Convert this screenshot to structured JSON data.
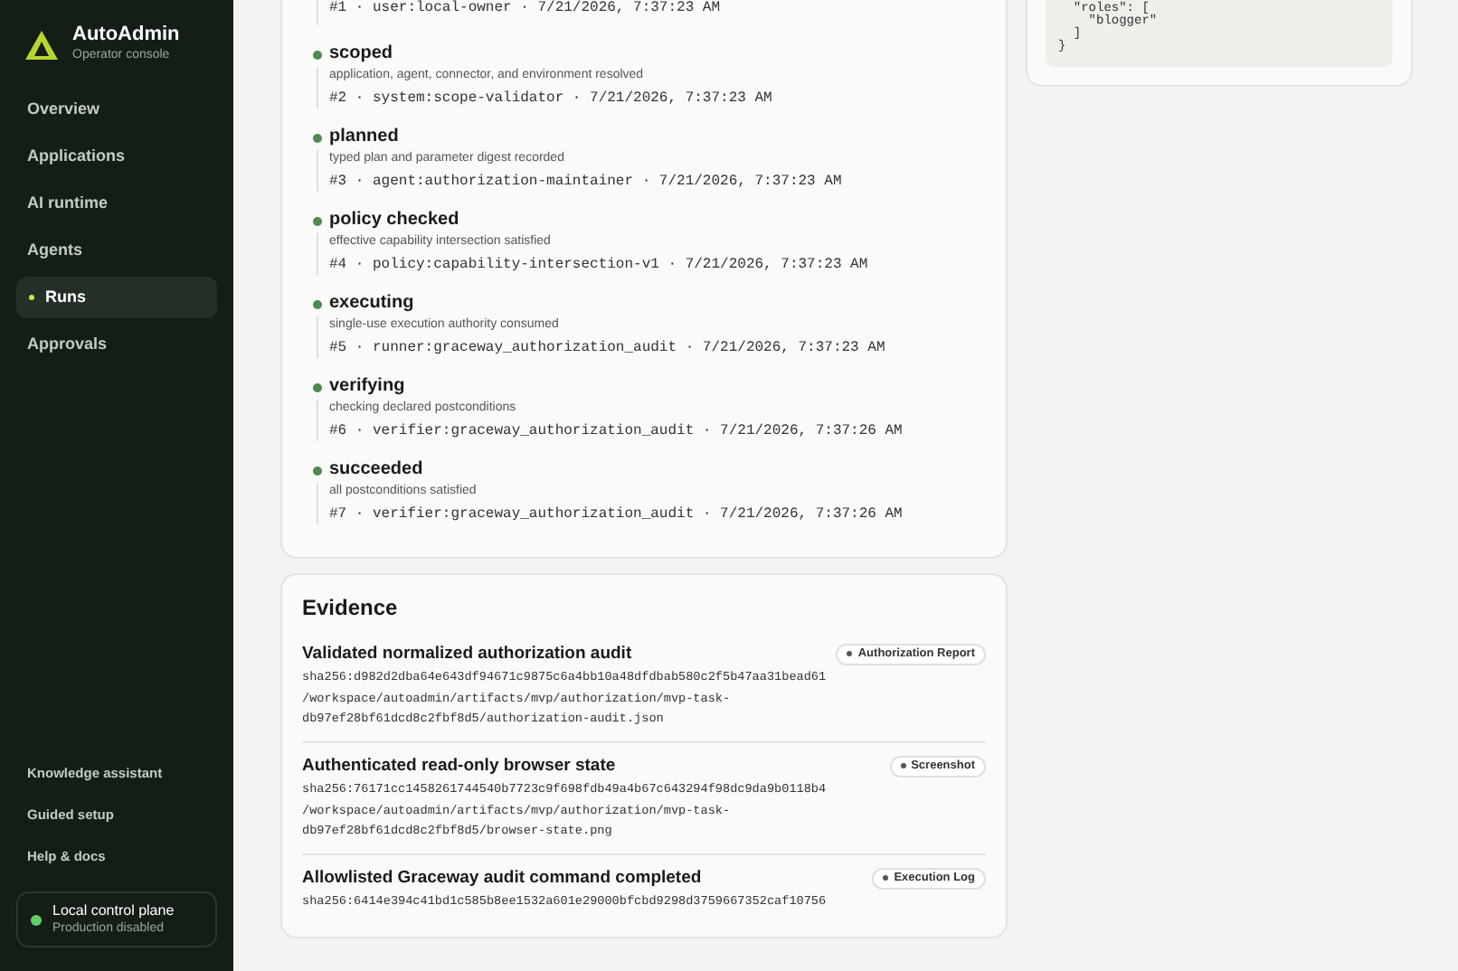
{
  "brand": {
    "name": "AutoAdmin",
    "subtitle": "Operator console"
  },
  "nav": [
    {
      "label": "Overview",
      "selected": false
    },
    {
      "label": "Applications",
      "selected": false
    },
    {
      "label": "AI runtime",
      "selected": false
    },
    {
      "label": "Agents",
      "selected": false
    },
    {
      "label": "Runs",
      "selected": true
    },
    {
      "label": "Approvals",
      "selected": false
    }
  ],
  "secondary_nav": [
    "Knowledge assistant",
    "Guided setup",
    "Help & docs"
  ],
  "environment": {
    "title": "Local control plane",
    "subtitle": "Production disabled",
    "color": "#5fd16a"
  },
  "timeline": {
    "first_meta": "#1 · user:local-owner · 7/21/2026, 7:37:23 AM",
    "events": [
      {
        "state": "scoped",
        "detail": "application, agent, connector, and environment resolved",
        "meta": "#2 · system:scope-validator · 7/21/2026, 7:37:23 AM"
      },
      {
        "state": "planned",
        "detail": "typed plan and parameter digest recorded",
        "meta": "#3 · agent:authorization-maintainer · 7/21/2026, 7:37:23 AM"
      },
      {
        "state": "policy checked",
        "detail": "effective capability intersection satisfied",
        "meta": "#4 · policy:capability-intersection-v1 · 7/21/2026, 7:37:23 AM"
      },
      {
        "state": "executing",
        "detail": "single-use execution authority consumed",
        "meta": "#5 · runner:graceway_authorization_audit · 7/21/2026, 7:37:23 AM"
      },
      {
        "state": "verifying",
        "detail": "checking declared postconditions",
        "meta": "#6 · verifier:graceway_authorization_audit · 7/21/2026, 7:37:26 AM"
      },
      {
        "state": "succeeded",
        "detail": "all postconditions satisfied",
        "meta": "#7 · verifier:graceway_authorization_audit · 7/21/2026, 7:37:26 AM"
      }
    ]
  },
  "evidence": {
    "title": "Evidence",
    "items": [
      {
        "title": "Validated normalized authorization audit",
        "badge": "Authorization Report",
        "hash": "sha256:d982d2dba64e643df94671c9875c6a4bb10a48dfdbab580c2f5b47aa31bead61",
        "path": "/workspace/autoadmin/artifacts/mvp/authorization/mvp-task-db97ef28bf61dcd8c2fbf8d5/authorization-audit.json"
      },
      {
        "title": "Authenticated read-only browser state",
        "badge": "Screenshot",
        "hash": "sha256:76171cc1458261744540b7723c9f698fdb49a4b67c643294f98dc9da9b0118b4",
        "path": "/workspace/autoadmin/artifacts/mvp/authorization/mvp-task-db97ef28bf61dcd8c2fbf8d5/browser-state.png"
      },
      {
        "title": "Allowlisted Graceway audit command completed",
        "badge": "Execution Log",
        "hash": "sha256:6414e394c41bd1c585b8ee1532a601e29000bfcbd9298d3759667352caf10756"
      }
    ]
  },
  "request_json": [
    "  \"roles\": [",
    "    \"blogger\"",
    "  ]",
    "}"
  ]
}
